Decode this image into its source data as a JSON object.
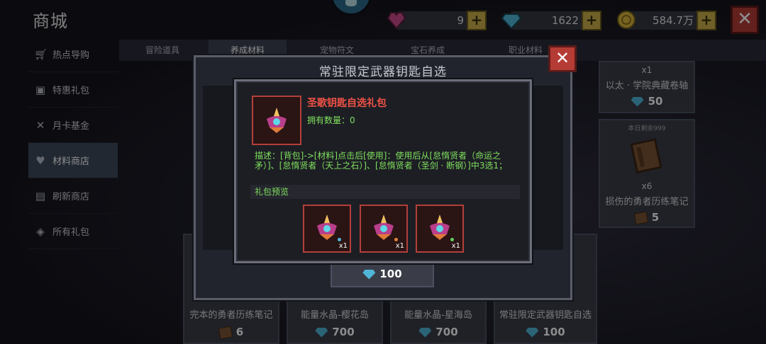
{
  "header": {
    "title": "商城",
    "currencies": [
      {
        "name": "heart-gem",
        "value": "9",
        "color": "#c84a8a"
      },
      {
        "name": "diamond",
        "value": "1622",
        "color": "#4fb6d8"
      },
      {
        "name": "gold-coin",
        "value": "584.7万",
        "color": "#d8b53a"
      }
    ],
    "plus_label": "+",
    "close_label": "✕"
  },
  "sidebar": {
    "items": [
      {
        "label": "热点导购",
        "icon": "cart-icon"
      },
      {
        "label": "特惠礼包",
        "icon": "gift-icon"
      },
      {
        "label": "月卡基金",
        "icon": "calendar-icon"
      },
      {
        "label": "材料商店",
        "icon": "material-icon"
      },
      {
        "label": "刷新商店",
        "icon": "refresh-icon"
      },
      {
        "label": "所有礼包",
        "icon": "all-gifts-icon"
      }
    ],
    "active_index": 3
  },
  "tabs": [
    {
      "label": "冒险道具"
    },
    {
      "label": "养成材料"
    },
    {
      "label": "宠物符文"
    },
    {
      "label": "宝石养成"
    },
    {
      "label": "职业材料"
    }
  ],
  "shop_cards": [
    {
      "name": "以太 · 学院典藏卷轴",
      "count": "x1",
      "price": "50"
    },
    {
      "name": "损伤的勇者历练笔记",
      "count": "x6",
      "price": "5",
      "limit": "本日剩余999"
    },
    {
      "name": "完本的勇者历练笔记",
      "price": "6"
    },
    {
      "name": "能量水晶-樱花岛",
      "price": "700"
    },
    {
      "name": "能量水晶-星海岛",
      "price": "700"
    },
    {
      "name": "常驻限定武器钥匙自选",
      "price": "100"
    }
  ],
  "outer_dialog": {
    "title": "常驻限定武器钥匙自选",
    "close_label": "✕",
    "price": "100"
  },
  "inner_dialog": {
    "item_title": "圣歌钥匙自选礼包",
    "owned": "拥有数量：0",
    "description": "描述：[背包]->[材料]点击后[使用]：使用后从[怠惰贤者（命运之矛）]、[怠惰贤者（天上之石）]、[怠惰贤者（圣剑 · 断钢）]中3选1；",
    "preview_label": "礼包预览",
    "preview_items": [
      {
        "qty": "x1",
        "dot_color": "#4fb6d8"
      },
      {
        "qty": "x1",
        "dot_color": "#e0823a"
      },
      {
        "qty": "x1",
        "dot_color": "#5fd05a"
      }
    ]
  }
}
